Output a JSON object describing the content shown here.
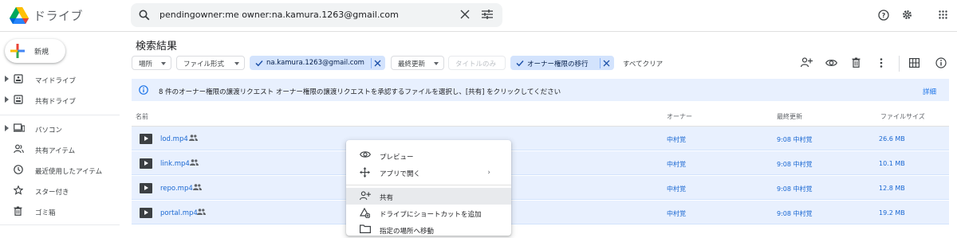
{
  "header": {
    "app_title": "ドライブ",
    "search_query": "pendingowner:me owner:na.kamura.1263@gmail.com"
  },
  "sidebar": {
    "new_label": "新規",
    "items": [
      {
        "label": "マイドライブ",
        "icon": "my-drive-icon"
      },
      {
        "label": "共有ドライブ",
        "icon": "shared-drives-icon"
      },
      {
        "label": "パソコン",
        "icon": "computers-icon"
      },
      {
        "label": "共有アイテム",
        "icon": "shared-with-me-icon"
      },
      {
        "label": "最近使用したアイテム",
        "icon": "clock-icon"
      },
      {
        "label": "スター付き",
        "icon": "star-icon"
      },
      {
        "label": "ゴミ箱",
        "icon": "trash-icon"
      }
    ]
  },
  "main": {
    "title": "検索結果",
    "filters": {
      "location": "場所",
      "file_type": "ファイル形式",
      "owner": "na.kamura.1263@gmail.com",
      "modified": "最終更新",
      "title_only": "タイトルのみ",
      "ownership_transfer": "オーナー権限の移行",
      "clear_all": "すべてクリア"
    },
    "banner": {
      "text": "8 件のオーナー権限の譲渡リクエスト  オーナー権限の譲渡リクエストを承認するファイルを選択し、[共有] をクリックしてください",
      "link": "詳細"
    },
    "columns": {
      "name": "名前",
      "owner": "オーナー",
      "modified": "最終更新",
      "size": "ファイルサイズ"
    },
    "rows": [
      {
        "name": "lod.mp4",
        "owner": "中村覚",
        "modified": "9:08 中村覚",
        "size": "26.6 MB"
      },
      {
        "name": "link.mp4",
        "owner": "中村覚",
        "modified": "9:08 中村覚",
        "size": "10.1 MB"
      },
      {
        "name": "repo.mp4",
        "owner": "中村覚",
        "modified": "9:08 中村覚",
        "size": "12.8 MB"
      },
      {
        "name": "portal.mp4",
        "owner": "中村覚",
        "modified": "9:08 中村覚",
        "size": "19.2 MB"
      }
    ]
  },
  "context_menu": {
    "items": [
      {
        "label": "プレビュー",
        "icon": "eye-icon"
      },
      {
        "label": "アプリで開く",
        "icon": "open-with-icon"
      },
      {
        "label": "共有",
        "icon": "person-add-icon"
      },
      {
        "label": "ドライブにショートカットを追加",
        "icon": "add-shortcut-icon"
      },
      {
        "label": "指定の場所へ移動",
        "icon": "move-icon"
      }
    ]
  },
  "colors": {
    "accent": "#1a73e8",
    "selected_row": "#e8f0fe",
    "chip_selected": "#d3e3fd"
  }
}
